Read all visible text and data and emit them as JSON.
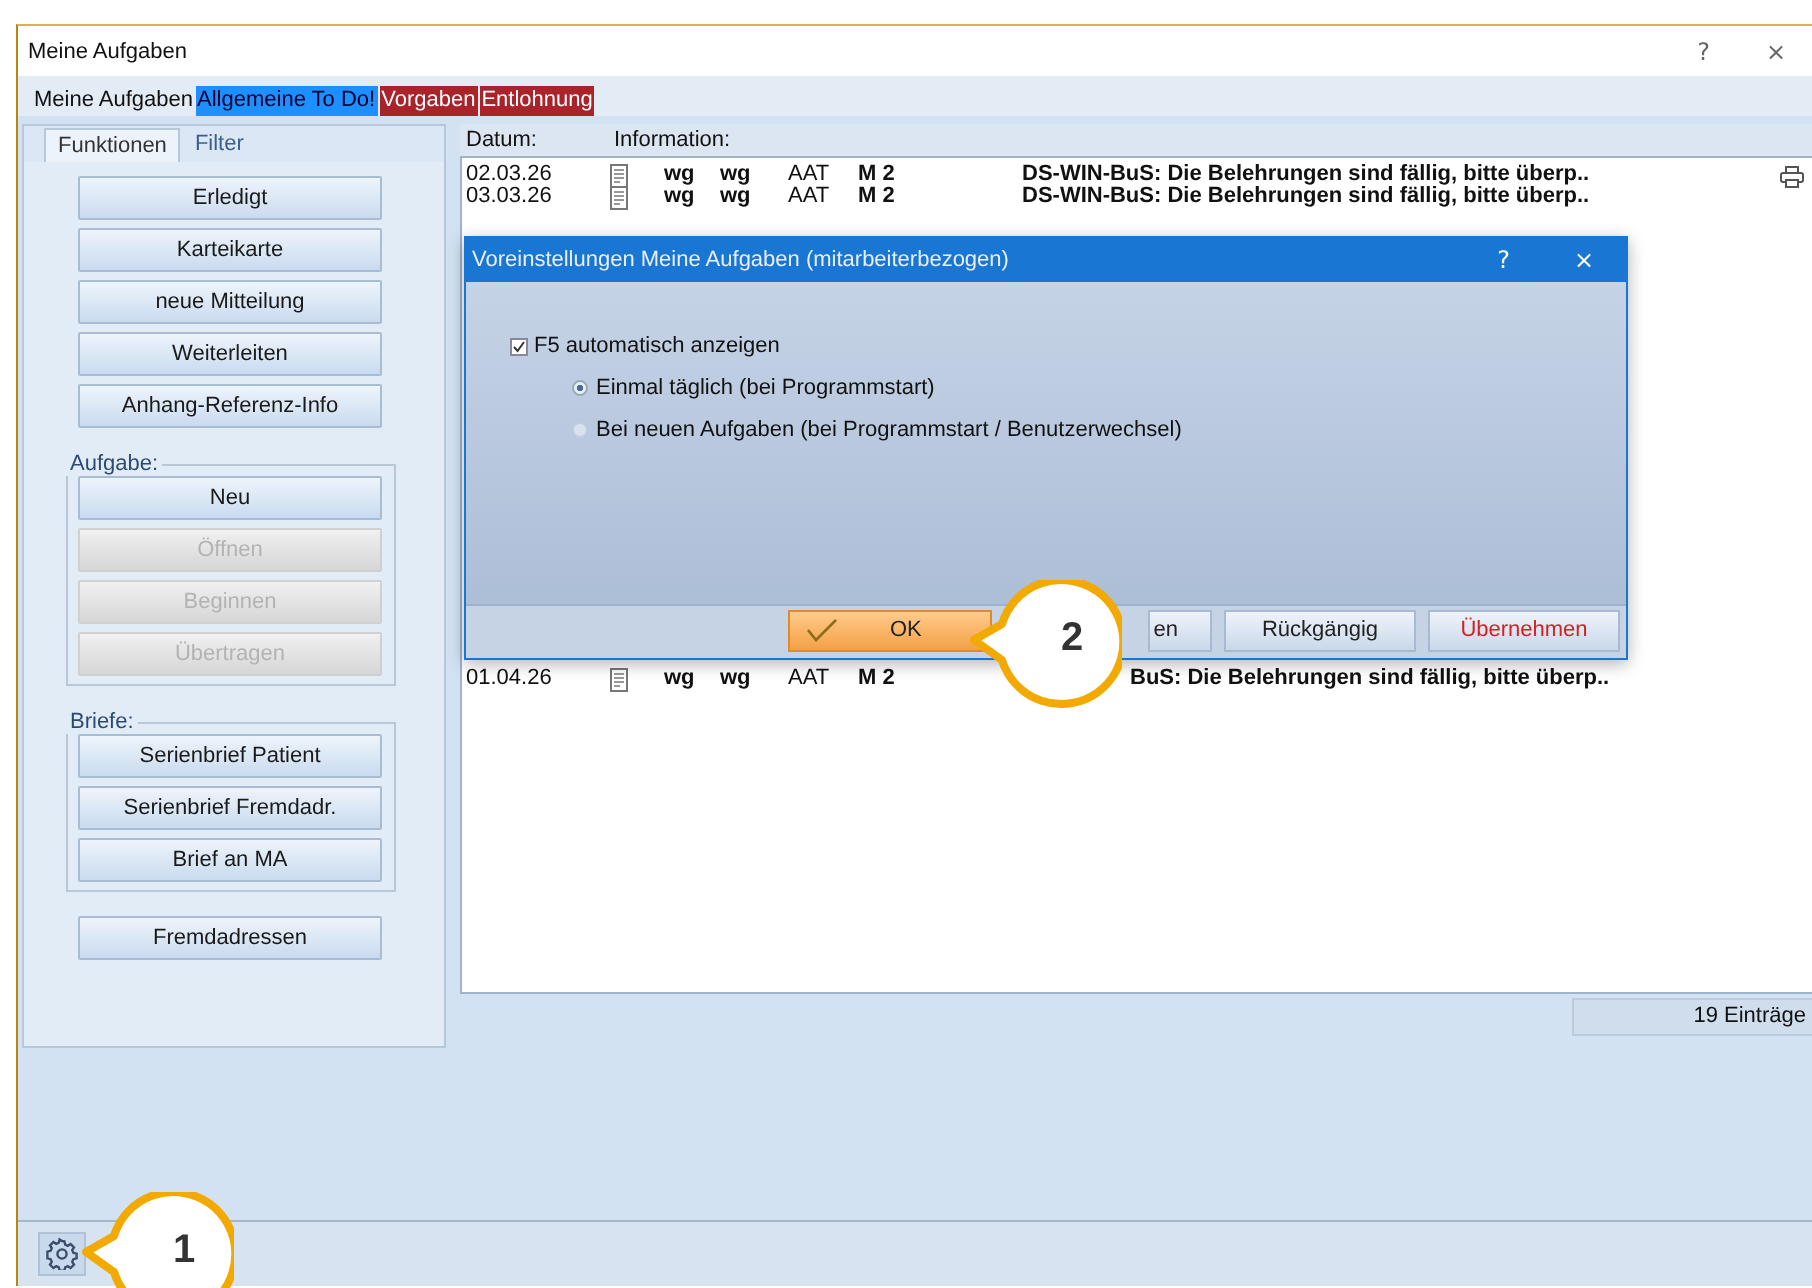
{
  "window": {
    "title": "Meine Aufgaben",
    "help": "?",
    "close": "×"
  },
  "categories": [
    {
      "label": "Meine Aufgaben"
    },
    {
      "label": "Allgemeine To Do!",
      "color": "#1e8fff"
    },
    {
      "label": "Vorgaben",
      "color": "#a8232a"
    },
    {
      "label": "Entlohnung",
      "color": "#a8232a"
    }
  ],
  "side_tabs": [
    {
      "label": "Funktionen",
      "selected": true
    },
    {
      "label": "Filter",
      "selected": false
    }
  ],
  "sections": [
    {
      "buttons": [
        {
          "label": "Erledigt",
          "disabled": false
        },
        {
          "label": "Karteikarte",
          "disabled": false
        },
        {
          "label": "neue Mitteilung",
          "disabled": false
        },
        {
          "label": "Weiterleiten",
          "disabled": false
        },
        {
          "label": "Anhang-Referenz-Info",
          "disabled": false
        }
      ]
    },
    {
      "title": "Aufgabe:",
      "buttons": [
        {
          "label": "Neu",
          "disabled": false
        },
        {
          "label": "Öffnen",
          "disabled": true
        },
        {
          "label": "Beginnen",
          "disabled": true
        },
        {
          "label": "Übertragen",
          "disabled": true
        }
      ]
    },
    {
      "title": "Briefe:",
      "buttons": [
        {
          "label": "Serienbrief Patient",
          "disabled": false
        },
        {
          "label": "Serienbrief Fremdadr.",
          "disabled": false
        },
        {
          "label": "Brief an MA",
          "disabled": false
        }
      ]
    },
    {
      "buttons": [
        {
          "label": "Fremdadressen",
          "disabled": false
        }
      ]
    }
  ],
  "list": {
    "columns": [
      "Datum:",
      "Information:"
    ],
    "rows": [
      {
        "date": "02.03.26",
        "user": "wg",
        "owner": "wg",
        "type": "AAT",
        "code": "M 2",
        "info": "DS-WIN-BuS: Die Belehrungen sind fällig, bitte überp.."
      },
      {
        "date": "03.03.26",
        "user": "wg",
        "owner": "wg",
        "type": "AAT",
        "code": "M 2",
        "info": "DS-WIN-BuS: Die Belehrungen sind fällig, bitte überp.."
      }
    ],
    "last_row": {
      "date": "01.04.26",
      "user": "wg",
      "owner": "wg",
      "type": "AAT",
      "code": "M 2",
      "info": "BuS: Die Belehrungen sind fällig, bitte überp.."
    }
  },
  "status": "19 Einträge",
  "dialog": {
    "title": "Voreinstellungen Meine Aufgaben (mitarbeiterbezogen)",
    "help": "?",
    "close": "×",
    "checkbox": {
      "label": "F5 automatisch anzeigen",
      "checked": true
    },
    "radios": [
      {
        "label": "Einmal täglich (bei Programmstart)",
        "selected": true
      },
      {
        "label": "Bei neuen Aufgaben (bei Programmstart / Benutzerwechsel)",
        "selected": false
      }
    ],
    "buttons": [
      {
        "label": "OK",
        "kind": "primary"
      },
      {
        "label": "en",
        "kind": "partial"
      },
      {
        "label": "Rückgängig",
        "kind": "normal"
      },
      {
        "label": "Übernehmen",
        "kind": "danger"
      }
    ]
  },
  "callouts": [
    "1",
    "2"
  ]
}
